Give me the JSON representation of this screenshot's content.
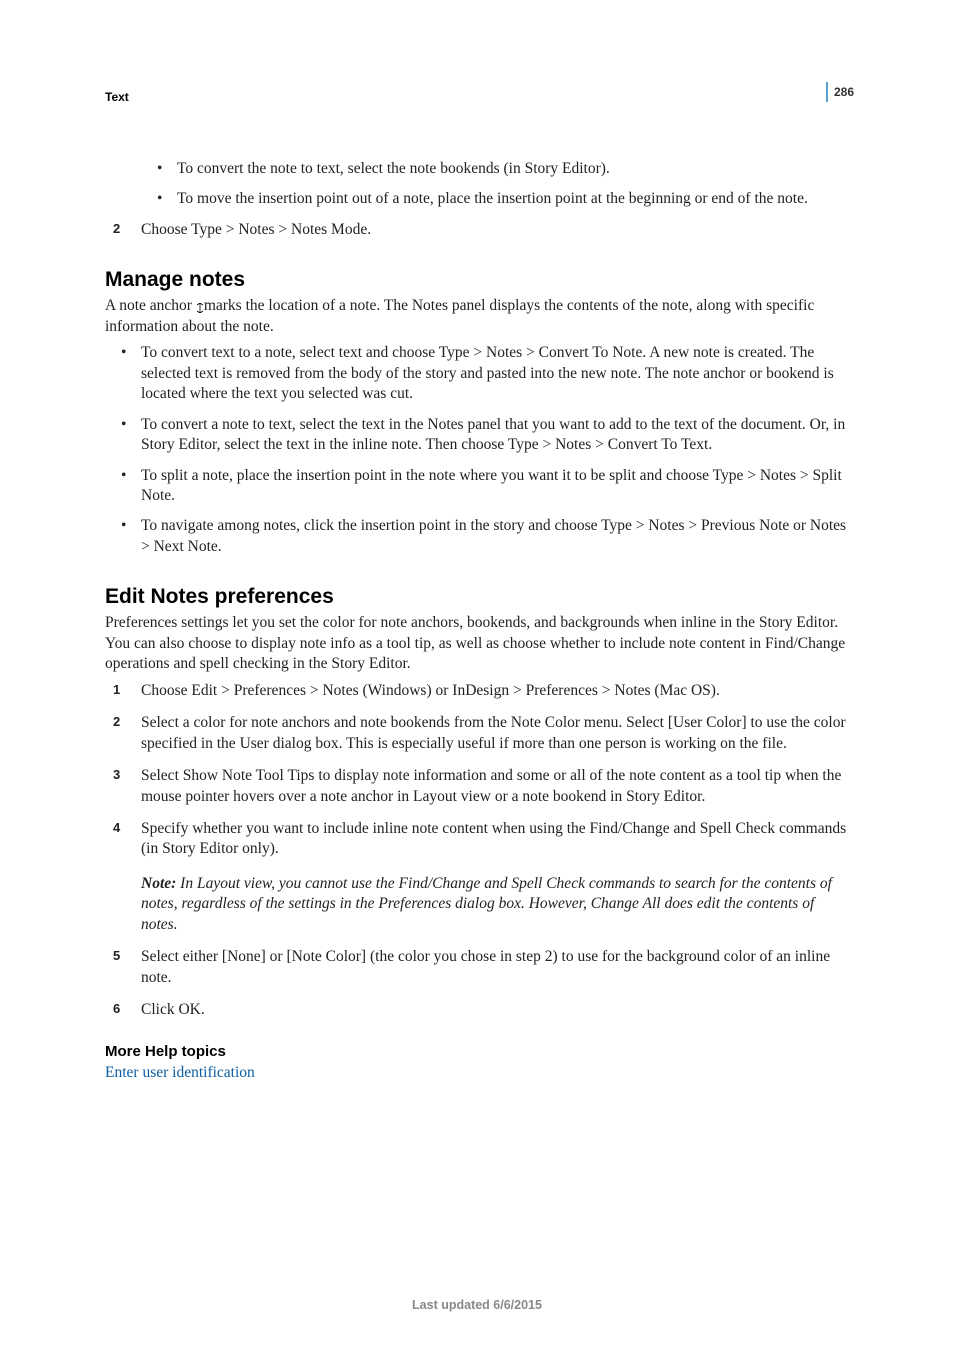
{
  "page_number": "286",
  "section_label": "Text",
  "intro_bullets": [
    "To convert the note to text, select the note bookends (in Story Editor).",
    "To move the insertion point out of a note, place the insertion point at the beginning or end of the note."
  ],
  "step_continue": "Choose Type > Notes > Notes Mode.",
  "manage": {
    "heading": "Manage notes",
    "intro_a": "A note anchor ",
    "intro_b": "marks the location of a note. The Notes panel displays the contents of the note, along with specific information about the note.",
    "bullets": [
      "To convert text to a note, select text and choose Type > Notes > Convert To Note. A new note is created. The selected text is removed from the body of the story and pasted into the new note. The note anchor or bookend is located where the text you selected was cut.",
      "To convert a note to text, select the text in the Notes panel that you want to add to the text of the document. Or, in Story Editor, select the text in the inline note. Then choose Type > Notes > Convert To Text.",
      "To split a note, place the insertion point in the note where you want it to be split and choose Type > Notes > Split Note.",
      "To navigate among notes, click the insertion point in the story and choose Type > Notes > Previous Note or Notes > Next Note."
    ]
  },
  "edit": {
    "heading": "Edit Notes preferences",
    "intro": "Preferences settings let you set the color for note anchors, bookends, and backgrounds when inline in the Story Editor. You can also choose to display note info as a tool tip, as well as choose whether to include note content in Find/Change operations and spell checking in the Story Editor.",
    "steps": [
      "Choose Edit > Preferences > Notes (Windows) or InDesign > Preferences > Notes (Mac OS).",
      "Select a color for note anchors and note bookends from the Note Color menu. Select [User Color] to use the color specified in the User dialog box. This is especially useful if more than one person is working on the file.",
      "Select Show Note Tool Tips to display note information and some or all of the note content as a tool tip when the mouse pointer hovers over a note anchor in Layout view or a note bookend in Story Editor.",
      "Specify whether you want to include inline note content when using the Find/Change and Spell Check commands (in Story Editor only)."
    ],
    "note_label": "Note:",
    "note_text": " In Layout view, you cannot use the Find/Change and Spell Check commands to search for the contents of notes, regardless of the settings in the Preferences dialog box. However, Change All does edit the contents of notes.",
    "steps_tail": [
      "Select either [None] or [Note Color] (the color you chose in step 2) to use for the background color of an inline note.",
      "Click OK."
    ]
  },
  "more_help": {
    "heading": "More Help topics",
    "link": "Enter user identification"
  },
  "footer": "Last updated 6/6/2015"
}
